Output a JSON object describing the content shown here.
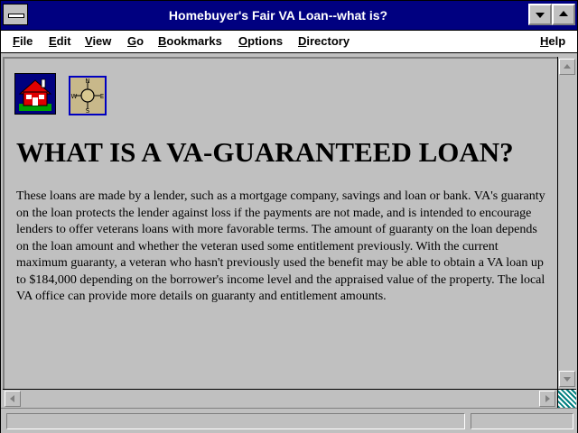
{
  "window": {
    "title": "Homebuyer's Fair VA Loan--what is?"
  },
  "menu": [
    "File",
    "Edit",
    "View",
    "Go",
    "Bookmarks",
    "Options",
    "Directory",
    "Help"
  ],
  "page": {
    "heading": "WHAT IS A VA-GUARANTEED LOAN?",
    "body": "These loans are made by a lender, such as a mortgage company, savings and loan or bank. VA's guaranty on the loan protects the lender against loss if the payments are not made, and is intended to encourage lenders to offer veterans loans with more favorable terms. The amount of guaranty on the loan depends on the loan amount and whether the veteran used some entitlement previously. With the current maximum guaranty, a veteran who hasn't previously used the benefit may be able to obtain a VA loan up to $184,000 depending on the borrower's income level and the appraised value of the property. The local VA office can provide more details on guaranty and entitlement amounts.",
    "icons": [
      "home-icon",
      "compass-icon"
    ],
    "compass": {
      "n": "N",
      "e": "E",
      "s": "S",
      "w": "W"
    }
  },
  "status": {
    "text": ""
  },
  "colors": {
    "titlebar": "#000080",
    "window": "#c0c0c0",
    "accent_corner": "#008080"
  }
}
